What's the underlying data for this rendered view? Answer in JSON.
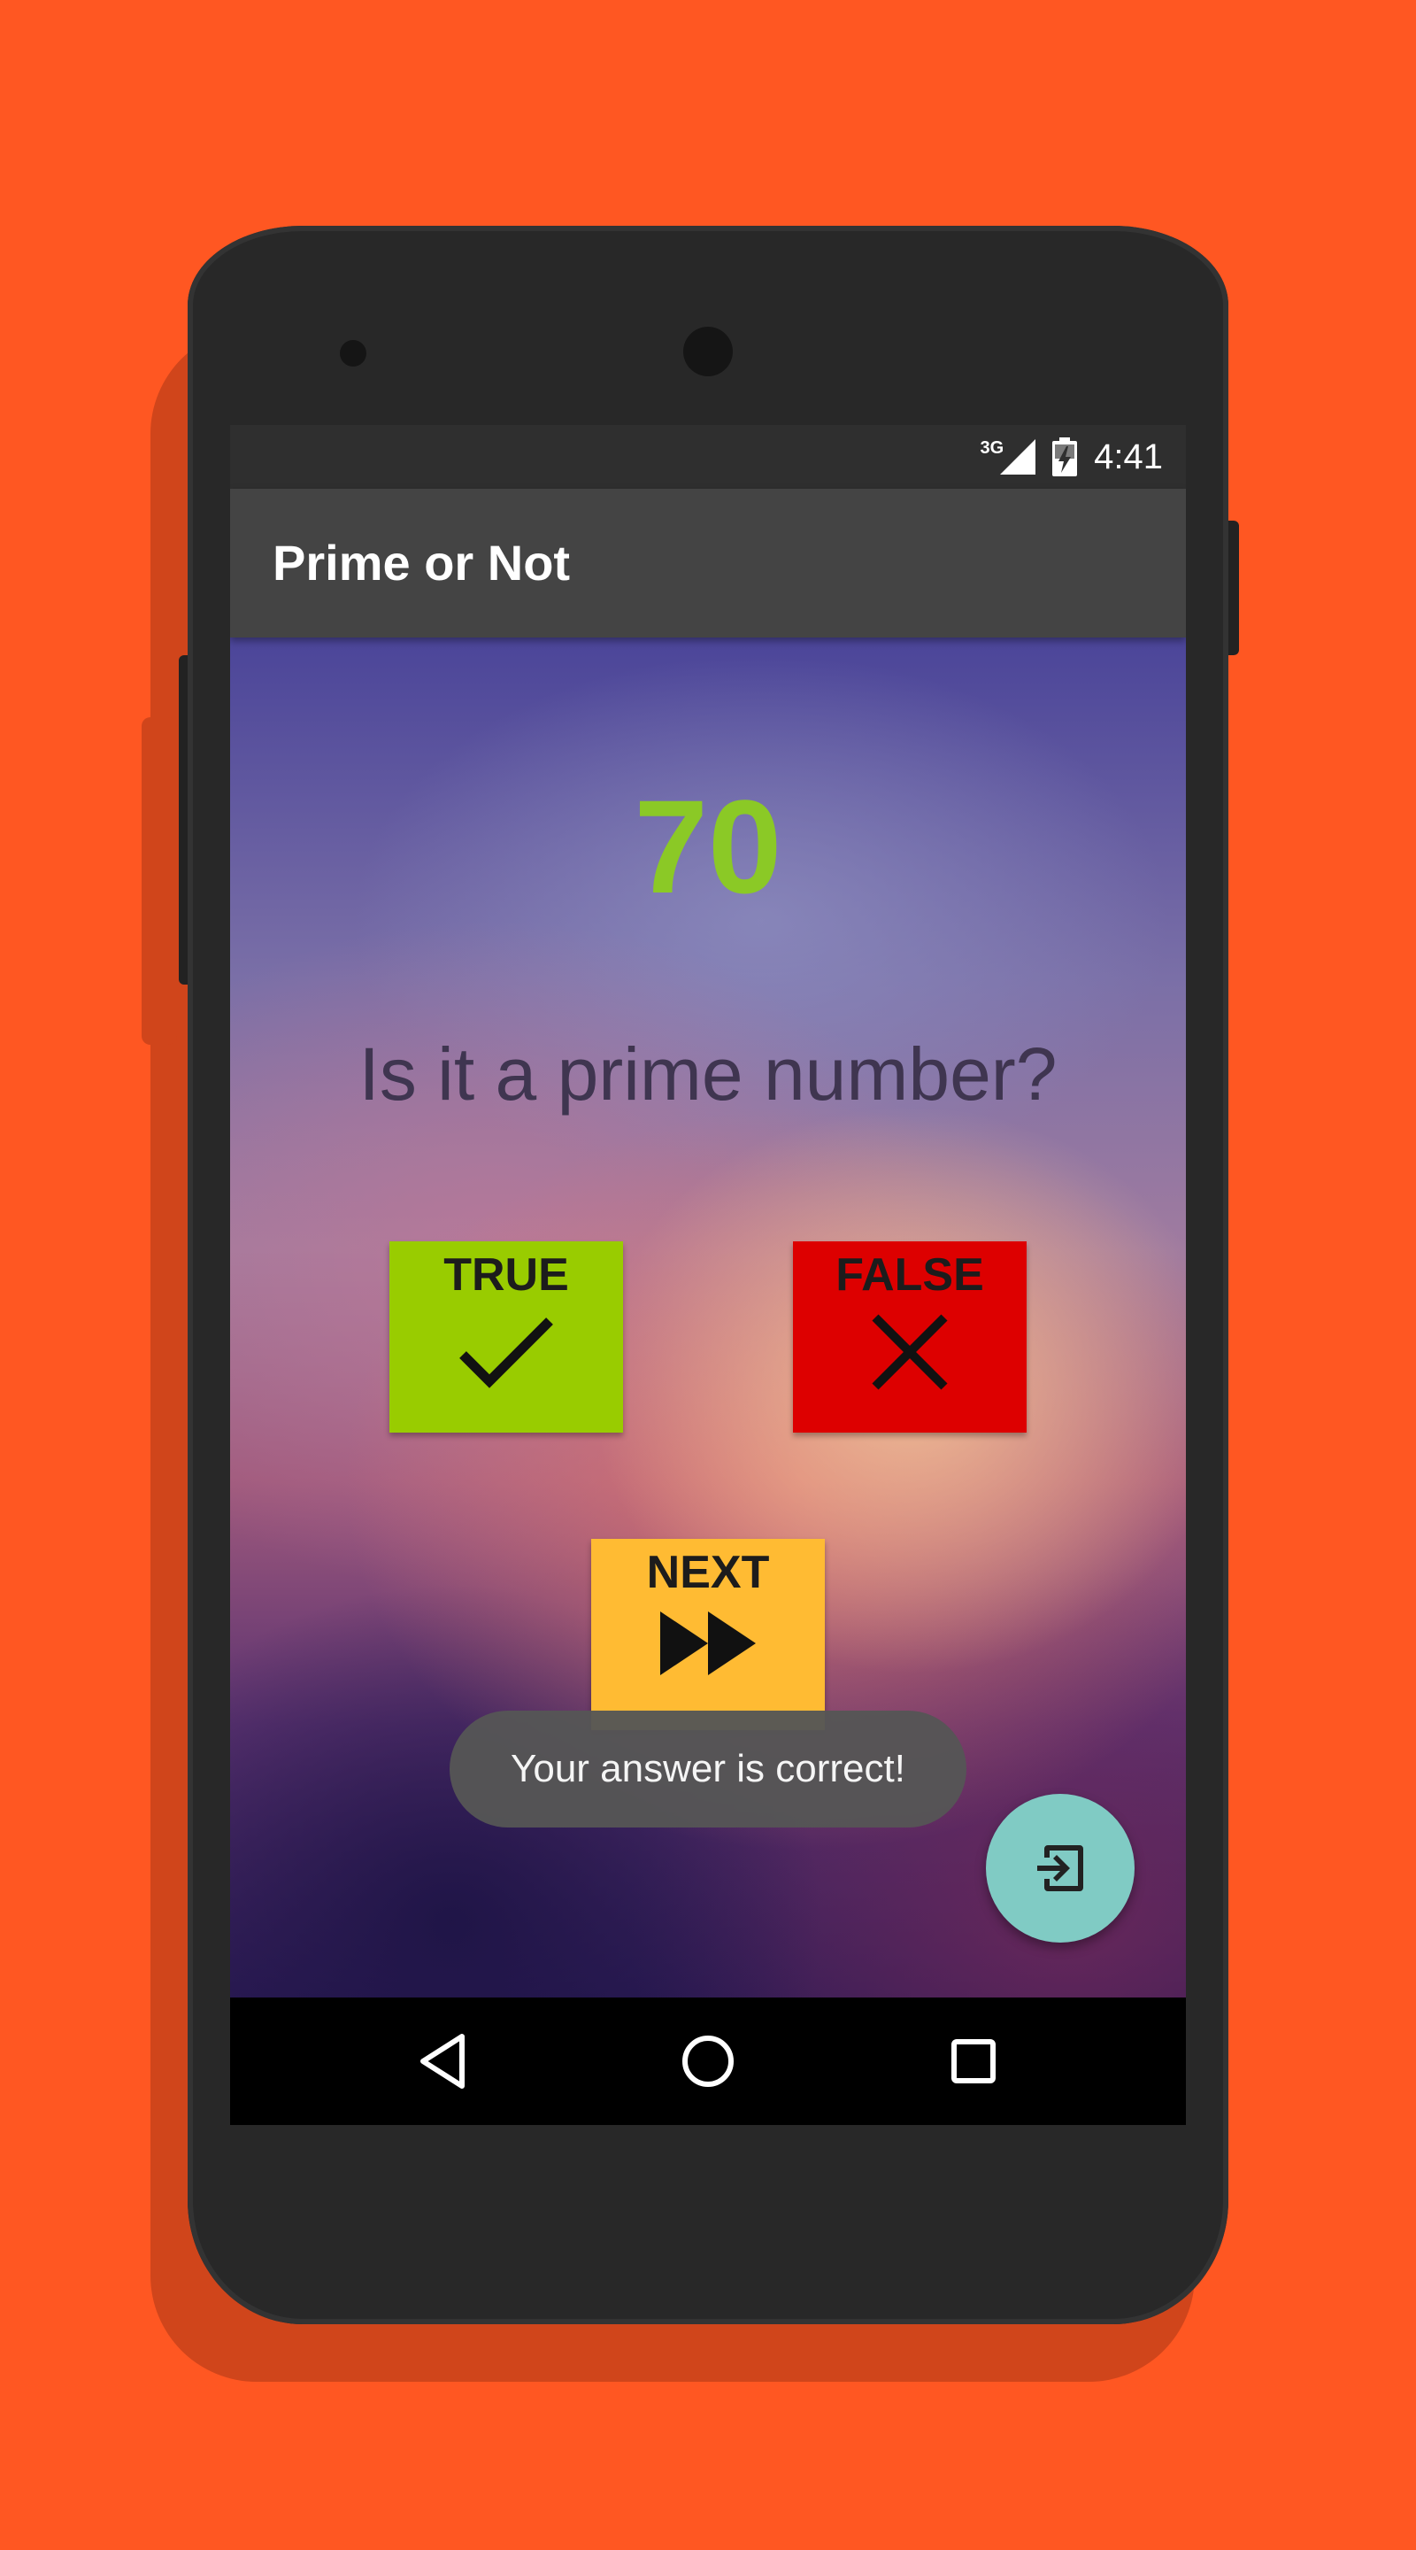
{
  "status_bar": {
    "network": "3G",
    "time": "4:41"
  },
  "app_bar": {
    "title": "Prime or Not"
  },
  "quiz": {
    "number": "70",
    "question": "Is it a prime number?"
  },
  "buttons": {
    "true_label": "TRUE",
    "false_label": "FALSE",
    "next_label": "NEXT"
  },
  "toast": {
    "message": "Your answer is correct!"
  },
  "colors": {
    "background": "#ff5722",
    "app_bar": "#444444",
    "number": "#8bc926",
    "true_button": "#99cc00",
    "false_button": "#dd0000",
    "next_button": "#ffbb33",
    "fab": "#80cbc4"
  },
  "icons": {
    "true": "check-icon",
    "false": "close-icon",
    "next": "fast-forward-icon",
    "fab": "exit-to-app-icon",
    "nav": [
      "back-icon",
      "home-icon",
      "recents-icon"
    ]
  }
}
